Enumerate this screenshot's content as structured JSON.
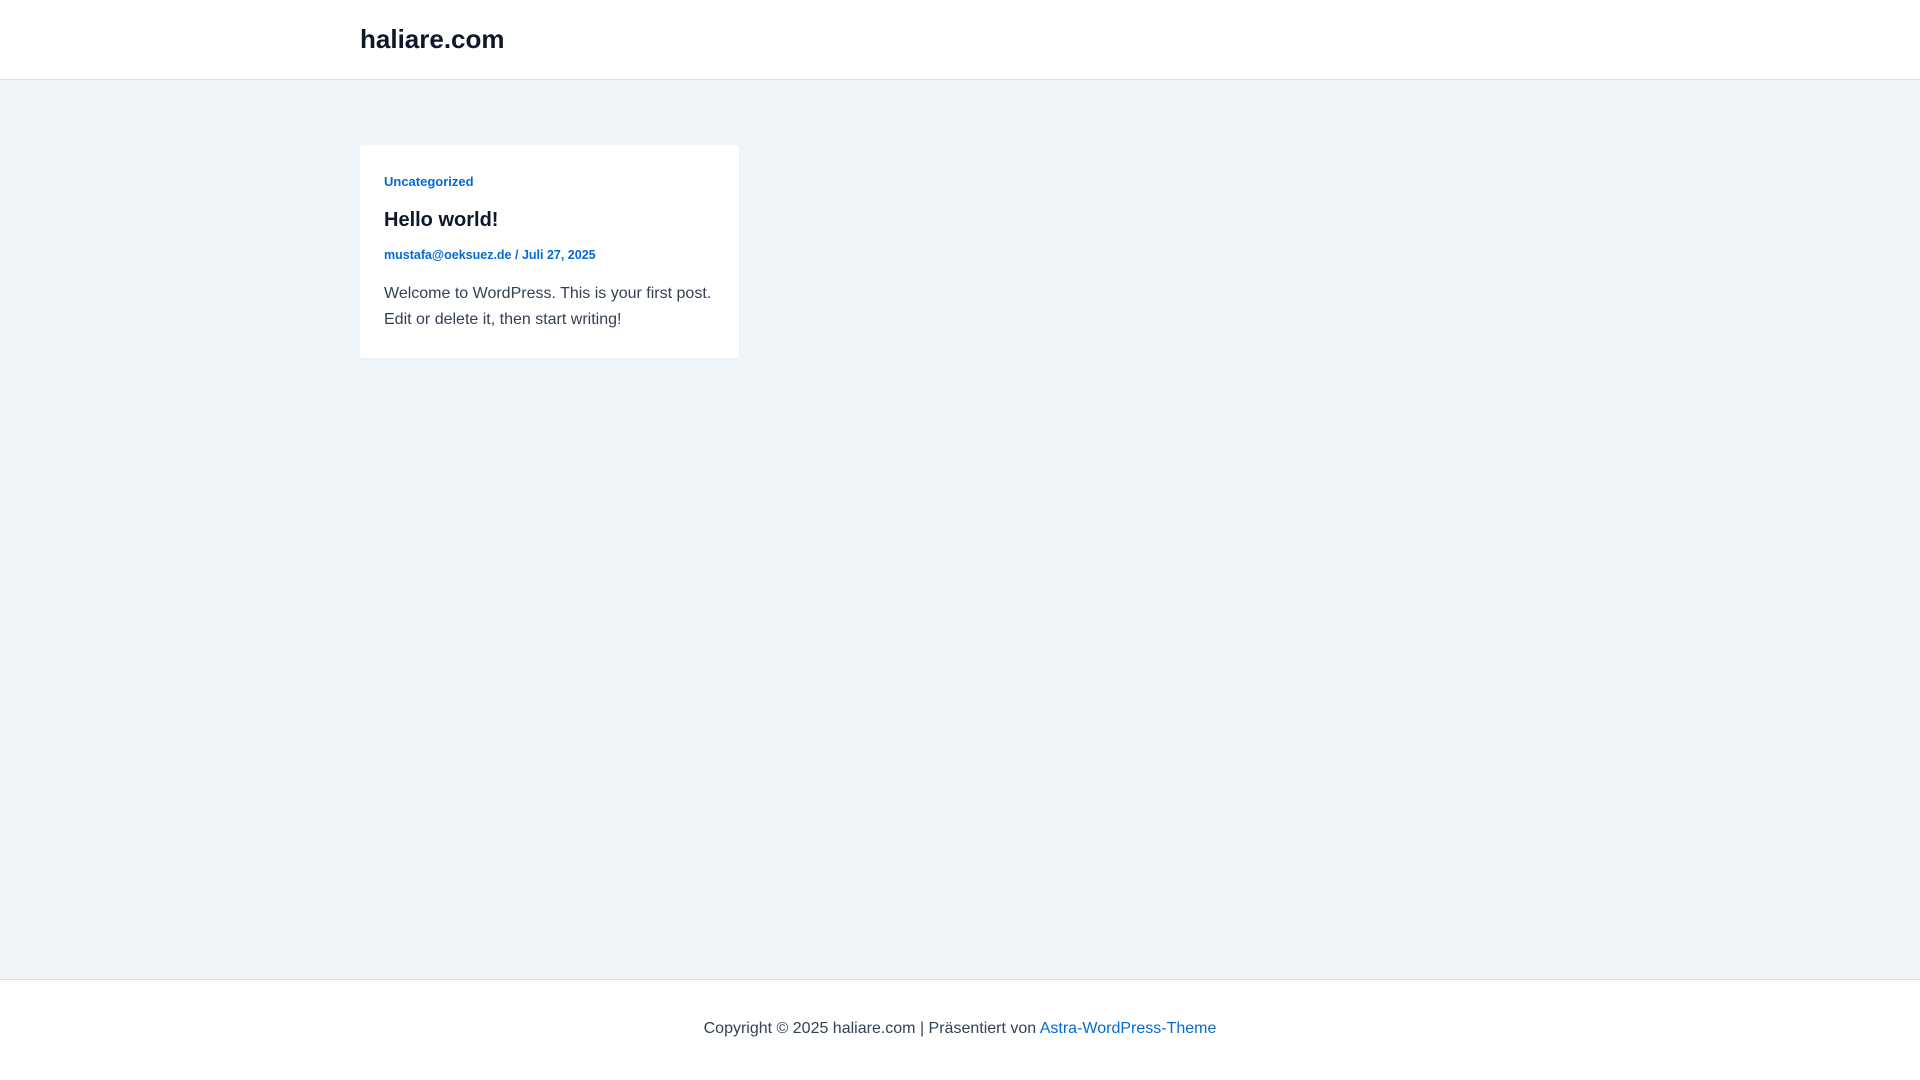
{
  "header": {
    "site_title": "haliare.com"
  },
  "post": {
    "category": "Uncategorized",
    "title": "Hello world!",
    "author": "mustafa@oeksuez.de",
    "meta_separator": " / ",
    "date": "Juli 27, 2025",
    "excerpt": "Welcome to WordPress. This is your first post. Edit or delete it, then start writing!"
  },
  "footer": {
    "copyright": "Copyright © 2025 haliare.com | Präsentiert von ",
    "theme_link": "Astra-WordPress-Theme"
  },
  "colors": {
    "accent": "#046bd2",
    "heading": "#0f172a",
    "body_text": "#334155",
    "background": "#f0f5fa"
  }
}
